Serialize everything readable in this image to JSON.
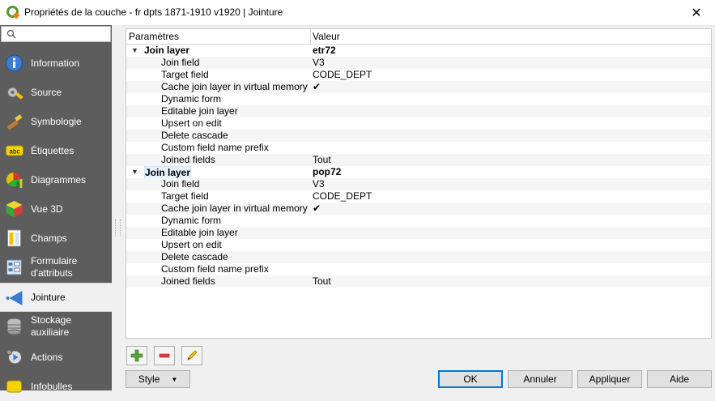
{
  "window": {
    "title": "Propriétés de la couche - fr dpts 1871-1910 v1920 | Jointure",
    "close_label": "✕"
  },
  "search": {
    "placeholder": ""
  },
  "sidebar": {
    "items": [
      {
        "label": "Information",
        "icon": "info-icon"
      },
      {
        "label": "Source",
        "icon": "source-icon"
      },
      {
        "label": "Symbologie",
        "icon": "symbology-icon"
      },
      {
        "label": "Étiquettes",
        "icon": "labels-icon"
      },
      {
        "label": "Diagrammes",
        "icon": "diagram-icon"
      },
      {
        "label": "Vue 3D",
        "icon": "cube-3d-icon"
      },
      {
        "label": "Champs",
        "icon": "fields-icon"
      },
      {
        "label": "Formulaire\nd'attributs",
        "icon": "form-icon"
      },
      {
        "label": "Jointure",
        "icon": "join-icon",
        "active": true
      },
      {
        "label": "Stockage\nauxiliaire",
        "icon": "storage-icon"
      },
      {
        "label": "Actions",
        "icon": "actions-icon"
      },
      {
        "label": "Infobulles",
        "icon": "tooltip-icon"
      }
    ]
  },
  "tree": {
    "columns": [
      "Paramètres",
      "Valeur"
    ],
    "rows": [
      {
        "key": "Join layer",
        "value": "etr72",
        "parent": true
      },
      {
        "key": "Join field",
        "value": "V3"
      },
      {
        "key": "Target field",
        "value": "CODE_DEPT"
      },
      {
        "key": "Cache join layer in virtual memory",
        "value": "✔"
      },
      {
        "key": "Dynamic form",
        "value": ""
      },
      {
        "key": "Editable join layer",
        "value": ""
      },
      {
        "key": "Upsert on edit",
        "value": ""
      },
      {
        "key": "Delete cascade",
        "value": ""
      },
      {
        "key": "Custom field name prefix",
        "value": ""
      },
      {
        "key": "Joined fields",
        "value": "Tout"
      },
      {
        "key": "Join layer",
        "value": "pop72",
        "parent": true,
        "selected": true
      },
      {
        "key": "Join field",
        "value": "V3"
      },
      {
        "key": "Target field",
        "value": "CODE_DEPT"
      },
      {
        "key": "Cache join layer in virtual memory",
        "value": "✔"
      },
      {
        "key": "Dynamic form",
        "value": ""
      },
      {
        "key": "Editable join layer",
        "value": ""
      },
      {
        "key": "Upsert on edit",
        "value": ""
      },
      {
        "key": "Delete cascade",
        "value": ""
      },
      {
        "key": "Custom field name prefix",
        "value": ""
      },
      {
        "key": "Joined fields",
        "value": "Tout"
      }
    ]
  },
  "toolbar": {
    "add_icon": "add-join-icon",
    "remove_icon": "remove-join-icon",
    "edit_icon": "edit-join-icon"
  },
  "footer": {
    "style_label": "Style",
    "ok_label": "OK",
    "cancel_label": "Annuler",
    "apply_label": "Appliquer",
    "help_label": "Aide"
  },
  "colors": {
    "sidebar_bg": "#5d5d5d",
    "accent": "#0078d7"
  }
}
